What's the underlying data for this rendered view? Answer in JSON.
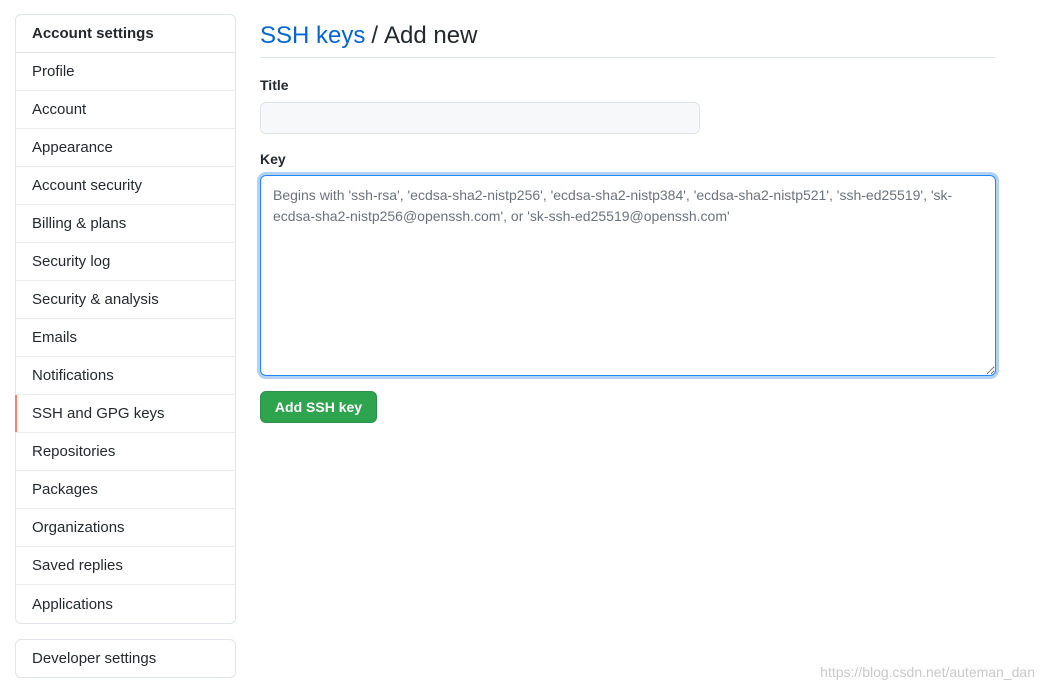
{
  "sidebar": {
    "header": "Account settings",
    "items": [
      {
        "label": "Profile"
      },
      {
        "label": "Account"
      },
      {
        "label": "Appearance"
      },
      {
        "label": "Account security"
      },
      {
        "label": "Billing & plans"
      },
      {
        "label": "Security log"
      },
      {
        "label": "Security & analysis"
      },
      {
        "label": "Emails"
      },
      {
        "label": "Notifications"
      },
      {
        "label": "SSH and GPG keys",
        "selected": true
      },
      {
        "label": "Repositories"
      },
      {
        "label": "Packages"
      },
      {
        "label": "Organizations"
      },
      {
        "label": "Saved replies"
      },
      {
        "label": "Applications"
      }
    ],
    "developer_settings": "Developer settings"
  },
  "header": {
    "breadcrumb_link": "SSH keys",
    "separator": "/",
    "title": "Add new"
  },
  "form": {
    "title_label": "Title",
    "title_value": "",
    "key_label": "Key",
    "key_placeholder": "Begins with 'ssh-rsa', 'ecdsa-sha2-nistp256', 'ecdsa-sha2-nistp384', 'ecdsa-sha2-nistp521', 'ssh-ed25519', 'sk-ecdsa-sha2-nistp256@openssh.com', or 'sk-ssh-ed25519@openssh.com'",
    "submit_label": "Add SSH key"
  },
  "watermark": "https://blog.csdn.net/auteman_dan",
  "colors": {
    "link": "#0366d6",
    "primary_button": "#2ea44f",
    "selected_indicator": "#f9826c",
    "focus_border": "#2188ff"
  }
}
